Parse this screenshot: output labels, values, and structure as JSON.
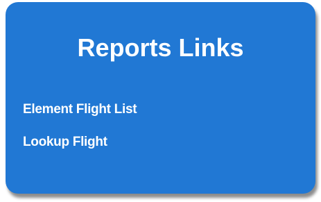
{
  "panel": {
    "title": "Reports Links",
    "links": [
      {
        "label": "Element Flight List"
      },
      {
        "label": "Lookup Flight"
      }
    ]
  },
  "colors": {
    "panel_background": "#2178d4",
    "text": "#ffffff"
  }
}
